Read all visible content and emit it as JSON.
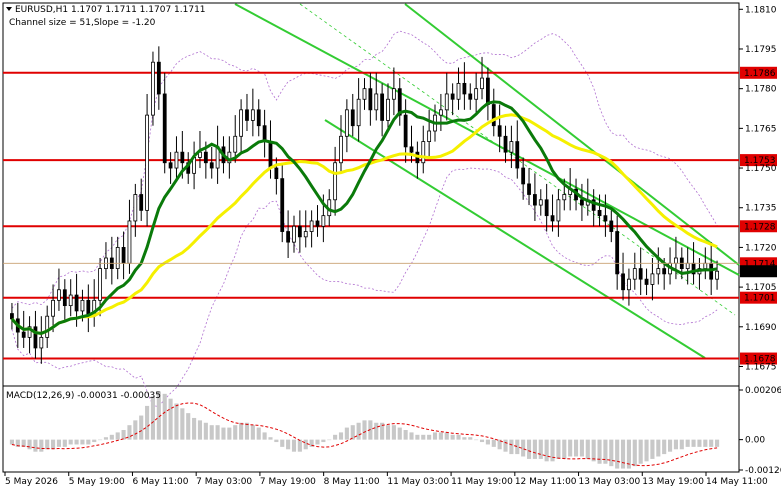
{
  "header": {
    "symbol_line": "EURUSD,H1  1.1707 1.1711 1.1707 1.1711",
    "channel_line": "Channel size = 51,Slope = -1.20"
  },
  "macd": {
    "label": "MACD(12,26,9) -0.00031 -0.00035",
    "ticks": [
      "0.00206",
      "0.00",
      "-0.00126"
    ]
  },
  "colors": {
    "level_line": "#e00000",
    "level_box": "#e00000",
    "ma_fast": "#0a7a0a",
    "ma_slow": "#f5f000",
    "channel": "#33cc33",
    "bands": "#b070d0",
    "price_box": "#000000",
    "candles": "#000000",
    "macd_hist": "#c8c8c8",
    "macd_signal": "#e00000"
  },
  "chart_data": {
    "type": "candlestick",
    "symbol": "EURUSD",
    "timeframe": "H1",
    "ylim": [
      1.1668,
      1.1812
    ],
    "y_ticks": [
      "1.1810",
      "1.1795",
      "1.1780",
      "1.1765",
      "1.1750",
      "1.1735",
      "1.1720",
      "1.1705",
      "1.1690",
      "1.1675"
    ],
    "x_ticks": [
      "5 May 2026",
      "5 May 19:00",
      "6 May 11:00",
      "7 May 03:00",
      "7 May 19:00",
      "8 May 11:00",
      "11 May 03:00",
      "11 May 19:00",
      "12 May 11:00",
      "13 May 03:00",
      "13 May 19:00",
      "14 May 11:00"
    ],
    "levels": [
      {
        "value": 1.1786,
        "label": "1.1786"
      },
      {
        "value": 1.1753,
        "label": "1.1753"
      },
      {
        "value": 1.1728,
        "label": "1.1728"
      },
      {
        "value": 1.1701,
        "label": "1.1701"
      },
      {
        "value": 1.1678,
        "label": "1.1678"
      }
    ],
    "current_price": {
      "value": 1.1711,
      "label": "1.1711"
    },
    "prev_price": {
      "value": 1.1714,
      "label": "1.1714"
    },
    "close_series": [
      1.1693,
      1.1688,
      1.1686,
      1.169,
      1.1682,
      1.1686,
      1.1694,
      1.17,
      1.1704,
      1.1698,
      1.1702,
      1.1696,
      1.17,
      1.1694,
      1.17,
      1.1712,
      1.1716,
      1.1712,
      1.172,
      1.1714,
      1.173,
      1.174,
      1.1734,
      1.177,
      1.179,
      1.1778,
      1.1752,
      1.175,
      1.1756,
      1.1752,
      1.1748,
      1.1754,
      1.1756,
      1.1752,
      1.175,
      1.1758,
      1.1752,
      1.1756,
      1.1762,
      1.1772,
      1.1768,
      1.1772,
      1.1766,
      1.176,
      1.175,
      1.1746,
      1.1726,
      1.1722,
      1.1728,
      1.1724,
      1.1726,
      1.173,
      1.1728,
      1.1732,
      1.1738,
      1.1752,
      1.1762,
      1.1772,
      1.1766,
      1.1776,
      1.178,
      1.1772,
      1.1778,
      1.1768,
      1.1776,
      1.178,
      1.177,
      1.1758,
      1.1756,
      1.1752,
      1.176,
      1.1764,
      1.177,
      1.1772,
      1.1778,
      1.1776,
      1.1782,
      1.1778,
      1.1776,
      1.178,
      1.1784,
      1.1774,
      1.1766,
      1.1762,
      1.1756,
      1.176,
      1.175,
      1.1744,
      1.174,
      1.1736,
      1.1738,
      1.1732,
      1.173,
      1.1738,
      1.174,
      1.1742,
      1.1738,
      1.1736,
      1.1738,
      1.1734,
      1.1732,
      1.173,
      1.1726,
      1.171,
      1.1704,
      1.1708,
      1.1712,
      1.1708,
      1.1706,
      1.171,
      1.1712,
      1.171,
      1.1714,
      1.1716,
      1.1712,
      1.1714,
      1.171,
      1.1712,
      1.1714,
      1.1708,
      1.1711
    ],
    "macd_hist": [
      -0.0002,
      -0.0003,
      -0.0003,
      -0.0004,
      -0.0005,
      -0.0005,
      -0.0004,
      -0.0004,
      -0.0003,
      -0.0003,
      -0.0002,
      -0.0002,
      -0.0002,
      -0.0002,
      -0.0001,
      0.0,
      0.0001,
      0.0002,
      0.0003,
      0.0004,
      0.0006,
      0.0008,
      0.001,
      0.0014,
      0.0018,
      0.002,
      0.0019,
      0.0017,
      0.0015,
      0.0013,
      0.0011,
      0.0009,
      0.0008,
      0.0007,
      0.0006,
      0.0006,
      0.0005,
      0.0005,
      0.0006,
      0.0007,
      0.0007,
      0.0006,
      0.0005,
      0.0003,
      0.0001,
      -0.0001,
      -0.0003,
      -0.0004,
      -0.0005,
      -0.0005,
      -0.0004,
      -0.0003,
      -0.0002,
      -0.0001,
      0.0,
      0.0002,
      0.0003,
      0.0005,
      0.0006,
      0.0007,
      0.0008,
      0.0008,
      0.0007,
      0.0007,
      0.0006,
      0.0006,
      0.0005,
      0.0004,
      0.0003,
      0.0002,
      0.0002,
      0.0002,
      0.0003,
      0.0003,
      0.0003,
      0.0002,
      0.0002,
      0.0001,
      0.0001,
      0.0,
      -0.0001,
      -0.0002,
      -0.0003,
      -0.0004,
      -0.0005,
      -0.0006,
      -0.0006,
      -0.0007,
      -0.0008,
      -0.0008,
      -0.0008,
      -0.0009,
      -0.0009,
      -0.0008,
      -0.0008,
      -0.0007,
      -0.0007,
      -0.0007,
      -0.0008,
      -0.0009,
      -0.001,
      -0.001,
      -0.0011,
      -0.0012,
      -0.0012,
      -0.0012,
      -0.0011,
      -0.001,
      -0.0009,
      -0.0008,
      -0.0007,
      -0.0006,
      -0.0005,
      -0.0004,
      -0.0004,
      -0.0003,
      -0.0003,
      -0.0003,
      -0.0003,
      -0.0003,
      -0.0003
    ]
  }
}
